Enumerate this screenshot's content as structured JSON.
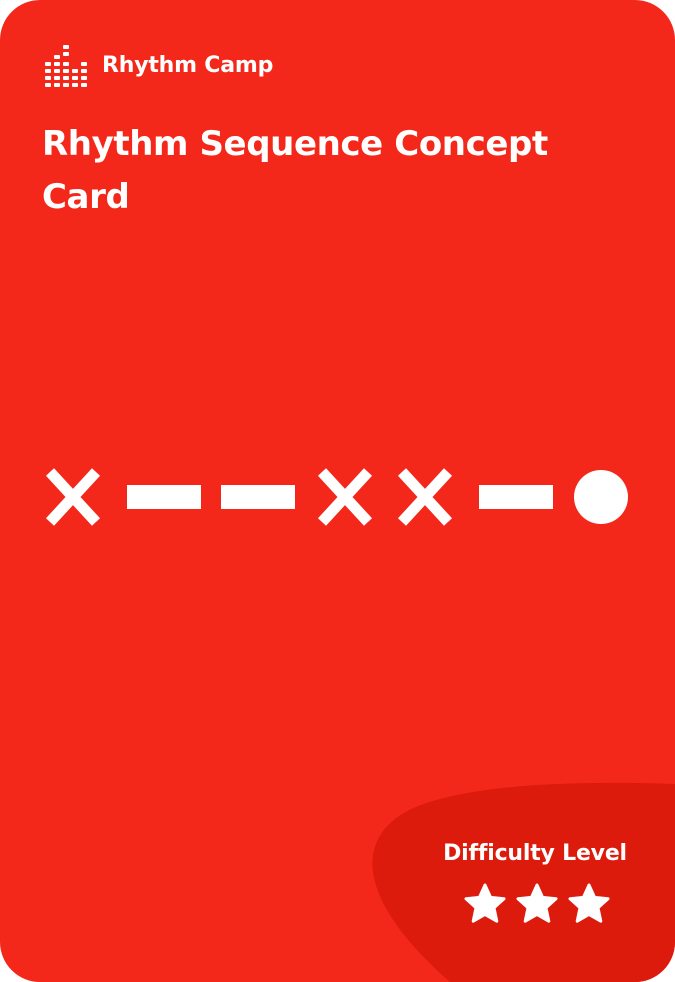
{
  "brand": {
    "name": "Rhythm Camp",
    "logo_icon": "equalizer-bars-icon"
  },
  "card": {
    "title": "Rhythm Sequence Concept Card",
    "background_color": "#f4281a",
    "accent_color": "#dc1b0c"
  },
  "sequence": [
    {
      "symbol": "x",
      "icon": "cross-icon"
    },
    {
      "symbol": "dash",
      "icon": "dash-icon"
    },
    {
      "symbol": "dash",
      "icon": "dash-icon"
    },
    {
      "symbol": "x",
      "icon": "cross-icon"
    },
    {
      "symbol": "x",
      "icon": "cross-icon"
    },
    {
      "symbol": "dash",
      "icon": "dash-icon"
    },
    {
      "symbol": "circle",
      "icon": "circle-icon"
    }
  ],
  "difficulty": {
    "label": "Difficulty Level",
    "stars_filled": 3,
    "stars_total": 3
  }
}
